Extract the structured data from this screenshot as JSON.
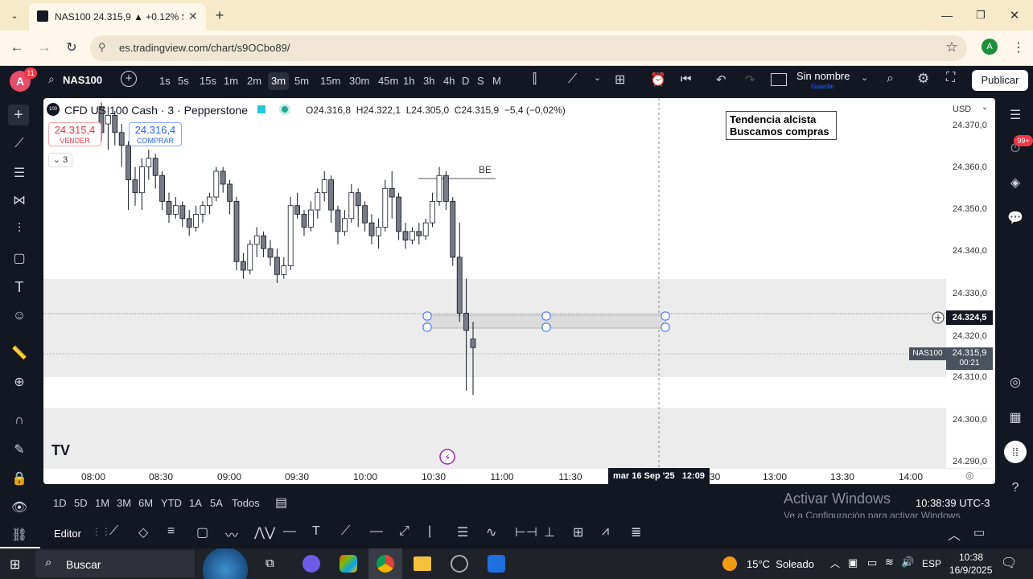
{
  "browser": {
    "tab_title": "NAS100 24.315,9 ▲ +0.12% Sin",
    "url": "es.tradingview.com/chart/s9OCbo89/",
    "profile_initial": "A"
  },
  "toolbar": {
    "alert_badge": "11",
    "symbol": "NAS100",
    "timeframes": [
      "1s",
      "5s",
      "15s",
      "1m",
      "2m",
      "3m",
      "5m",
      "15m",
      "30m",
      "45m",
      "1h",
      "3h",
      "4h",
      "D",
      "S",
      "M"
    ],
    "active_timeframe": "3m",
    "layout_name": "Sin nombre",
    "layout_sub": "Guardar",
    "publish_label": "Publicar"
  },
  "legend": {
    "title": "CFD US 100 Cash · 3 · Pepperstone",
    "ohlc": "O24.316,8  H24.322,1  L24.305,0  C24.315,9  −5,4 (−0,02%)",
    "sell_price": "24.315,4",
    "sell_label": "VENDER",
    "buy_price": "24.316,4",
    "buy_label": "COMPRAR",
    "indicators_count": "3"
  },
  "annotation": {
    "line1": "Tendencia alcista",
    "line2": "Buscamos compras",
    "be_label": "BE"
  },
  "price_axis": {
    "currency": "USD",
    "labels": [
      "24.370,0",
      "24.360,0",
      "24.350,0",
      "24.340,0",
      "24.330,0",
      "24.320,0",
      "24.310,0",
      "24.300,0",
      "24.290,0"
    ],
    "crosshair_price": "24.324,5",
    "symbol_tag": "NAS100",
    "last_price": "24.315,9",
    "countdown": "00:21"
  },
  "time_axis": {
    "labels": [
      "08:00",
      "08:30",
      "09:00",
      "09:30",
      "10:00",
      "10:30",
      "11:00",
      "11:30",
      "13:00",
      "13:30",
      "14:00"
    ],
    "crosshair_time": "mar 16 Sep '25   12:09",
    "partial_label": "30"
  },
  "bottom": {
    "ranges": [
      "1D",
      "5D",
      "1M",
      "3M",
      "6M",
      "YTD",
      "1A",
      "5A",
      "Todos"
    ],
    "clock": "10:38:39 UTC-3",
    "watermark1": "Activar Windows",
    "watermark2": "Ve a Configuración para activar Windows."
  },
  "drawbar": {
    "editor_label": "Editor"
  },
  "right_badge": "99+",
  "taskbar": {
    "search": "Buscar",
    "weather": "15°C  Soleado",
    "lang": "ESP",
    "time": "10:38",
    "date": "16/9/2025"
  },
  "chart_data": {
    "type": "candlestick",
    "ylim": [
      24288,
      24374
    ],
    "colors": {
      "up": "#ffffff",
      "down": "#787b86",
      "outline": "#131722"
    }
  }
}
